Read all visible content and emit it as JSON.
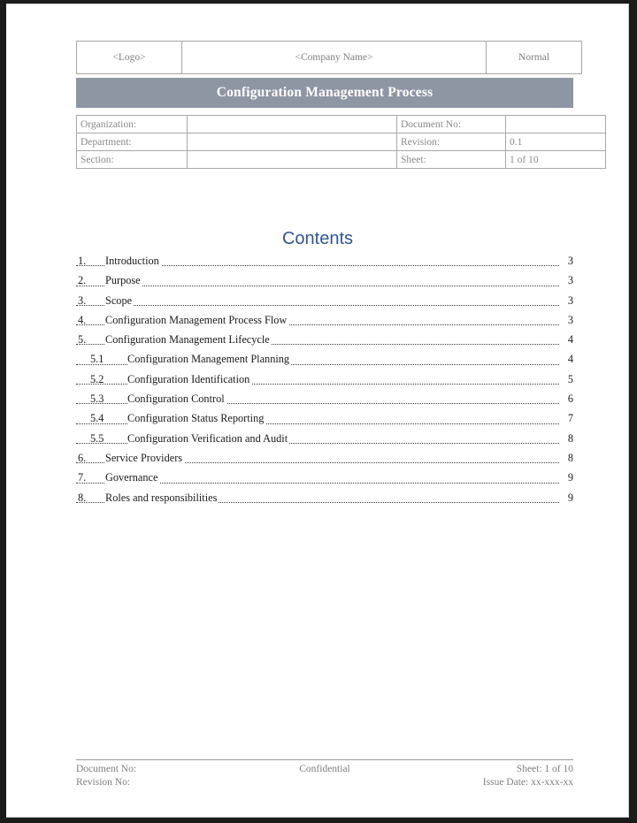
{
  "document": {
    "header_row": {
      "logo": "<Logo>",
      "company_name": "<Company Name>",
      "classification": "Normal"
    },
    "title": "Configuration Management Process",
    "title_band_color": "#8E96A4",
    "meta_table": {
      "rows": [
        {
          "label_left": "Organization:",
          "value_left": "",
          "label_right": "Document No:",
          "value_right": ""
        },
        {
          "label_left": "Department:",
          "value_left": "",
          "label_right": "Revision:",
          "value_right": "0.1"
        },
        {
          "label_left": "Section:",
          "value_left": "",
          "label_right": "Sheet:",
          "value_right": "1 of 10"
        }
      ]
    },
    "contents": {
      "heading": "Contents",
      "heading_color": "#2E5496",
      "entries": [
        {
          "level": 1,
          "number": "1.",
          "label": "Introduction",
          "page": "3"
        },
        {
          "level": 1,
          "number": "2.",
          "label": "Purpose",
          "page": "3"
        },
        {
          "level": 1,
          "number": "3.",
          "label": "Scope",
          "page": "3"
        },
        {
          "level": 1,
          "number": "4.",
          "label": "Configuration Management Process Flow",
          "page": "3"
        },
        {
          "level": 1,
          "number": "5.",
          "label": "Configuration Management Lifecycle",
          "page": "4"
        },
        {
          "level": 2,
          "number": "5.1",
          "label": "Configuration Management Planning",
          "page": "4"
        },
        {
          "level": 2,
          "number": "5.2",
          "label": "Configuration Identification",
          "page": "5"
        },
        {
          "level": 2,
          "number": "5.3",
          "label": "Configuration Control",
          "page": "6"
        },
        {
          "level": 2,
          "number": "5.4",
          "label": "Configuration Status Reporting",
          "page": "7"
        },
        {
          "level": 2,
          "number": "5.5",
          "label": "Configuration Verification and Audit",
          "page": "8"
        },
        {
          "level": 1,
          "number": "6.",
          "label": "Service Providers",
          "page": "8"
        },
        {
          "level": 1,
          "number": "7.",
          "label": "Governance",
          "page": "9"
        },
        {
          "level": 1,
          "number": "8.",
          "label": "Roles and responsibilities",
          "page": "9"
        }
      ]
    },
    "footer": {
      "document_no": "Document No:",
      "revision_no": "Revision No:",
      "confidential": "Confidential",
      "sheet": "Sheet: 1 of 10",
      "issue_date": "Issue Date: xx-xxx-xx"
    }
  }
}
